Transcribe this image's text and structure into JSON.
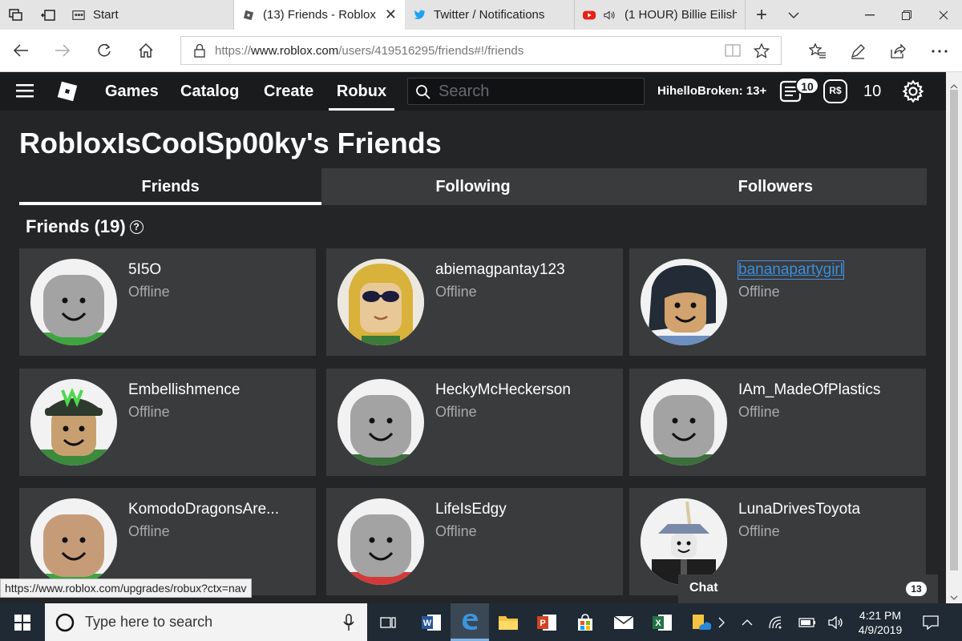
{
  "browser": {
    "tabs": [
      {
        "label": "Start"
      },
      {
        "label": "(13) Friends - Roblox",
        "close": "✕"
      },
      {
        "label": "Twitter / Notifications"
      },
      {
        "label": "(1 HOUR) Billie Eilish"
      }
    ],
    "new_tab": "+",
    "url_prefix": "https://",
    "url_host": "www.roblox.com",
    "url_path": "/users/419516295/friends#!/friends"
  },
  "roblox_nav": {
    "links": [
      "Games",
      "Catalog",
      "Create",
      "Robux"
    ],
    "search_placeholder": "Search",
    "username": "HihelloBroken: 13+",
    "messages_count": "10",
    "robux_label": "R$",
    "robux_amount": "10"
  },
  "page": {
    "title": "RobloxIsCoolSp00ky's Friends",
    "tabs": [
      "Friends",
      "Following",
      "Followers"
    ],
    "section_title": "Friends (19)",
    "help_glyph": "?"
  },
  "friends": [
    {
      "name": "5I5O",
      "status": "Offline"
    },
    {
      "name": "abiemagpantay123",
      "status": "Offline"
    },
    {
      "name": "bananapartygirl",
      "status": "Offline"
    },
    {
      "name": "Embellishmence",
      "status": "Offline"
    },
    {
      "name": "HeckyMcHeckerson",
      "status": "Offline"
    },
    {
      "name": "IAm_MadeOfPlastics",
      "status": "Offline"
    },
    {
      "name": "KomodoDragonsAre...",
      "status": "Offline"
    },
    {
      "name": "LifeIsEdgy",
      "status": "Offline"
    },
    {
      "name": "LunaDrivesToyota",
      "status": "Offline"
    }
  ],
  "status_link": "https://www.roblox.com/upgrades/robux?ctx=nav",
  "chat": {
    "label": "Chat",
    "count": "13"
  },
  "taskbar": {
    "search_placeholder": "Type here to search",
    "time": "4:21 PM",
    "date": "4/9/2019"
  },
  "colors": {
    "page_bg": "#232527",
    "card_bg": "#393b3d",
    "nav_bg": "#191b1d",
    "link_blue": "#3a8fdc",
    "taskbar_bg": "#1f2a35"
  }
}
